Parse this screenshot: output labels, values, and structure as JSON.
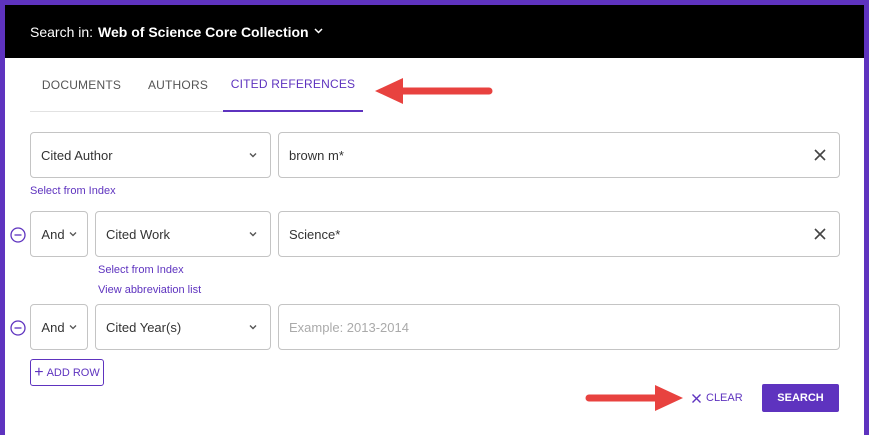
{
  "header": {
    "prefix": "Search in:",
    "collection": "Web of Science Core Collection"
  },
  "tabs": [
    {
      "label": "DOCUMENTS",
      "active": false
    },
    {
      "label": "AUTHORS",
      "active": false
    },
    {
      "label": "CITED REFERENCES",
      "active": true
    }
  ],
  "rows": [
    {
      "field": "Cited Author",
      "value": "brown m*",
      "links": [
        "Select from Index"
      ]
    },
    {
      "operator": "And",
      "field": "Cited Work",
      "value": "Science*",
      "links": [
        "Select from Index",
        "View abbreviation list"
      ]
    },
    {
      "operator": "And",
      "field": "Cited Year(s)",
      "placeholder": "Example: 2013-2014"
    }
  ],
  "actions": {
    "add_row": "ADD ROW",
    "clear": "CLEAR",
    "search": "SEARCH"
  },
  "colors": {
    "accent": "#5e33bf",
    "annotation_arrow": "#e8423f"
  }
}
